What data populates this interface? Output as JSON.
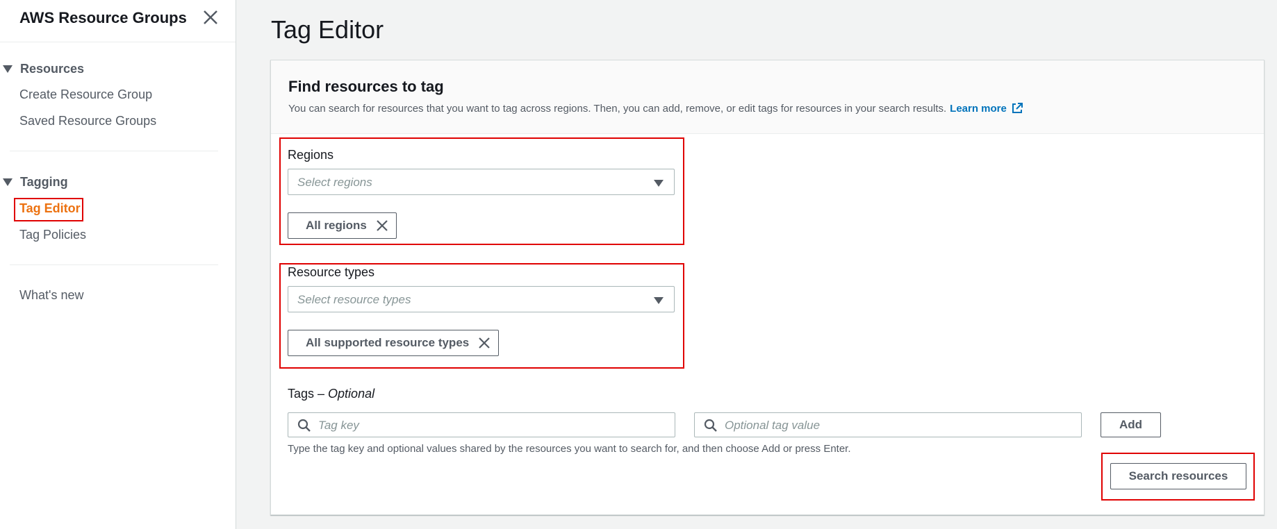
{
  "sidebar": {
    "title": "AWS Resource Groups",
    "sections": [
      {
        "label": "Resources",
        "items": [
          {
            "label": "Create Resource Group"
          },
          {
            "label": "Saved Resource Groups"
          }
        ]
      },
      {
        "label": "Tagging",
        "items": [
          {
            "label": "Tag Editor"
          },
          {
            "label": "Tag Policies"
          }
        ]
      }
    ],
    "whats_new": "What's new"
  },
  "main": {
    "title": "Tag Editor",
    "panel": {
      "title": "Find resources to tag",
      "description": "You can search for resources that you want to tag across regions. Then, you can add, remove, or edit tags for resources in your search results.",
      "learn_more": "Learn more",
      "regions": {
        "label": "Regions",
        "placeholder": "Select regions",
        "token": "All regions"
      },
      "resource_types": {
        "label": "Resource types",
        "placeholder": "Select resource types",
        "token": "All supported resource types"
      },
      "tags": {
        "label": "Tags – ",
        "label_optional": "Optional",
        "key_placeholder": "Tag key",
        "value_placeholder": "Optional tag value",
        "add_label": "Add",
        "hint": "Type the tag key and optional values shared by the resources you want to search for, and then choose Add or press Enter."
      },
      "search_label": "Search resources"
    }
  },
  "colors": {
    "accent_active": "#ec7211",
    "link": "#0073bb",
    "highlight": "#e00000"
  }
}
